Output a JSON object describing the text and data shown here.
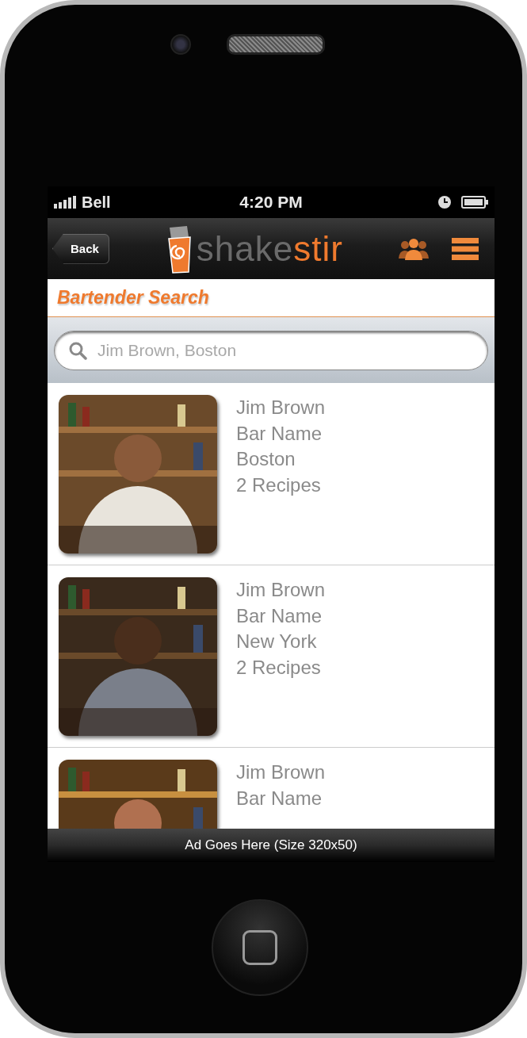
{
  "status_bar": {
    "carrier": "Bell",
    "time": "4:20 PM"
  },
  "nav_bar": {
    "back": "Back",
    "logo": {
      "text_dark": "shake",
      "text_accent": "stir"
    }
  },
  "page_title": "Bartender Search",
  "search": {
    "placeholder": "Jim Brown, Boston"
  },
  "bartenders": [
    {
      "name": "Jim Brown",
      "bar": "Bar Name",
      "city": "Boston",
      "recipes": "2 Recipes"
    },
    {
      "name": "Jim Brown",
      "bar": "Bar Name",
      "city": "New York",
      "recipes": "2 Recipes"
    },
    {
      "name": "Jim Brown",
      "bar": "Bar Name"
    }
  ],
  "ad_bar": "Ad Goes Here (Size 320x50)"
}
